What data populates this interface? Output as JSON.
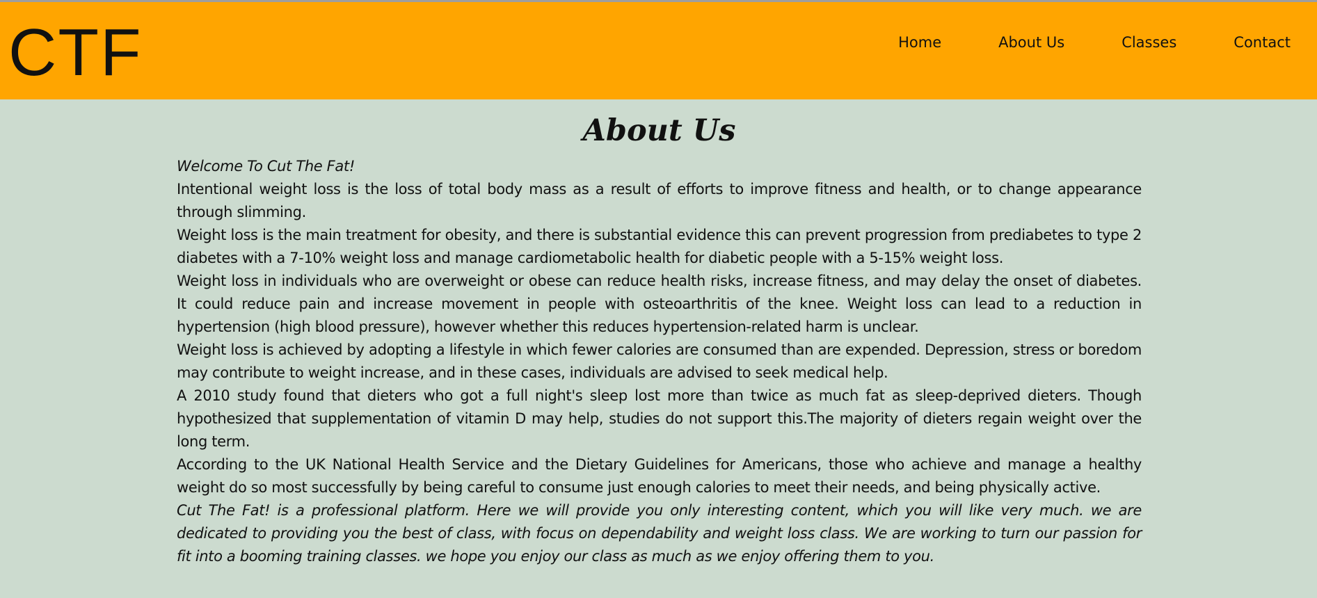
{
  "header": {
    "logo": "CTF",
    "nav": [
      {
        "label": "Home"
      },
      {
        "label": "About Us"
      },
      {
        "label": "Classes"
      },
      {
        "label": "Contact"
      }
    ],
    "bg_color": "#ffa500"
  },
  "main": {
    "title": "About Us",
    "bg_color": "#ccdbcf",
    "paragraphs": [
      "Welcome To Cut The Fat!",
      "Intentional weight loss is the loss of total body mass as a result of efforts to improve fitness and health, or to change appearance through slimming.",
      "Weight loss is the main treatment for obesity, and there is substantial evidence this can prevent progression from prediabetes to type 2 diabetes with a 7-10% weight loss and manage cardiometabolic health for diabetic people with a 5-15% weight loss.",
      "Weight loss in individuals who are overweight or obese can reduce health risks, increase fitness, and may delay the onset of diabetes. It could reduce pain and increase movement in people with osteoarthritis of the knee. Weight loss can lead to a reduction in hypertension (high blood pressure), however whether this reduces hypertension-related harm is unclear.",
      "Weight loss is achieved by adopting a lifestyle in which fewer calories are consumed than are expended. Depression, stress or boredom may contribute to weight increase, and in these cases, individuals are advised to seek medical help.",
      "A 2010 study found that dieters who got a full night's sleep lost more than twice as much fat as sleep-deprived dieters. Though hypothesized that supplementation of vitamin D may help, studies do not support this.The majority of dieters regain weight over the long term.",
      "According to the UK National Health Service and the Dietary Guidelines for Americans, those who achieve and manage a healthy weight do so most successfully by being careful to consume just enough calories to meet their needs, and being physically active.",
      "Cut The Fat! is a professional platform. Here we will provide you only interesting content, which you will like very much. we are dedicated to providing you the best of class, with focus on dependability and weight loss class. We are working to turn our passion for fit into a booming training classes. we hope you enjoy our class as much as we enjoy offering them to you."
    ]
  }
}
